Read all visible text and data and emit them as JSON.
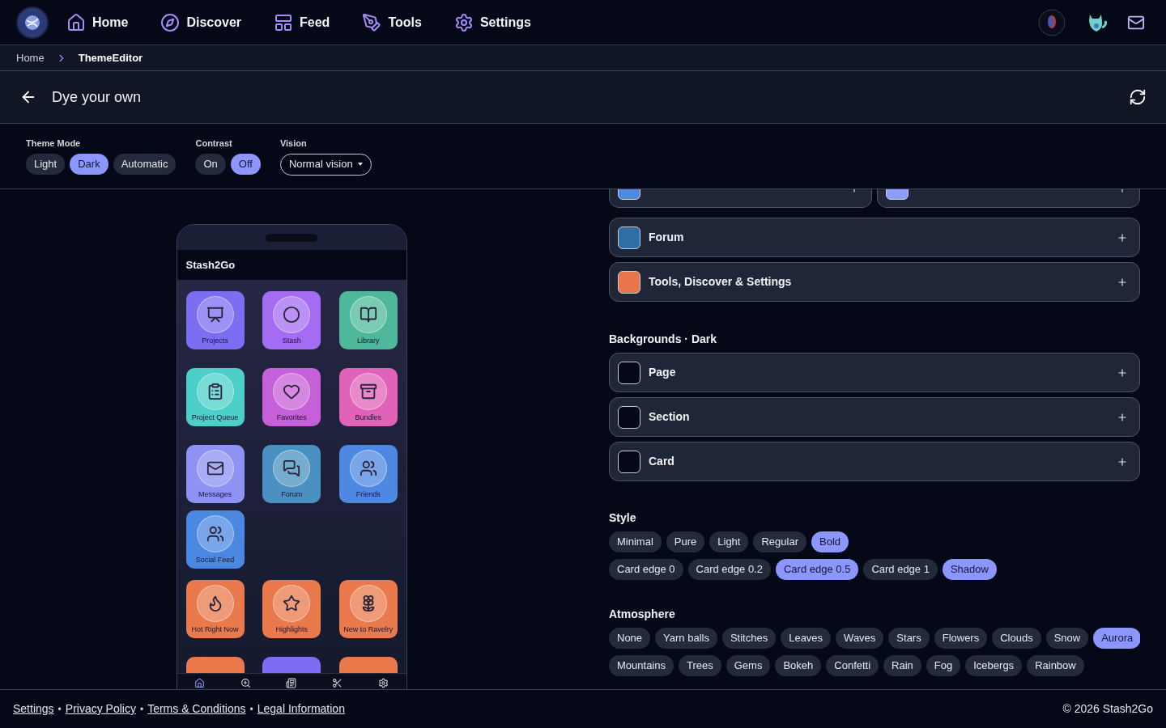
{
  "nav": {
    "items": [
      {
        "label": "Home"
      },
      {
        "label": "Discover"
      },
      {
        "label": "Feed"
      },
      {
        "label": "Tools"
      },
      {
        "label": "Settings"
      }
    ]
  },
  "breadcrumb": [
    {
      "label": "Home",
      "current": false
    },
    {
      "label": "ThemeEditor",
      "current": true
    }
  ],
  "header": {
    "title": "Dye your own"
  },
  "controls": {
    "theme_mode": {
      "label": "Theme Mode",
      "options": [
        {
          "label": "Light",
          "selected": false
        },
        {
          "label": "Dark",
          "selected": true
        },
        {
          "label": "Automatic",
          "selected": false
        }
      ]
    },
    "contrast": {
      "label": "Contrast",
      "options": [
        {
          "label": "On",
          "selected": false
        },
        {
          "label": "Off",
          "selected": true
        }
      ]
    },
    "vision": {
      "label": "Vision",
      "value": "Normal vision"
    }
  },
  "preview": {
    "app_title": "Stash2Go",
    "tiles": [
      {
        "label": "Projects",
        "color": "#7b6ef2"
      },
      {
        "label": "Stash",
        "color": "#a46cf2"
      },
      {
        "label": "Library",
        "color": "#4fb89b"
      },
      {
        "label": "Project Queue",
        "color": "#4ccfc8"
      },
      {
        "label": "Favorites",
        "color": "#c660d8"
      },
      {
        "label": "Bundles",
        "color": "#e062b9"
      },
      {
        "label": "Messages",
        "color": "#8e92f2"
      },
      {
        "label": "Forum",
        "color": "#4a90c2"
      },
      {
        "label": "Friends",
        "color": "#4e88e2"
      },
      {
        "label": "Social Feed",
        "color": "#4b88e2"
      },
      {
        "label": "Hot Right Now",
        "color": "#ea7a4c"
      },
      {
        "label": "Highlights",
        "color": "#ea7a4c"
      },
      {
        "label": "New to Ravelry",
        "color": "#ea7a4c"
      },
      {
        "color": "#ea7a4c"
      },
      {
        "color": "#7d6df5"
      },
      {
        "color": "#ea7a4c"
      }
    ],
    "tabbar": [
      {
        "selected": true
      },
      {
        "selected": false
      },
      {
        "selected": false
      },
      {
        "selected": false
      },
      {
        "selected": false
      }
    ]
  },
  "editor": {
    "pair": [
      {
        "color": "#4e88e2"
      },
      {
        "color": "#8e9bff"
      }
    ],
    "categories": [
      {
        "label": "Forum",
        "color": "#2f6ea6"
      },
      {
        "label": "Tools, Discover & Settings",
        "color": "#e8764a"
      }
    ],
    "backgrounds": {
      "title": "Backgrounds · Dark",
      "items": [
        {
          "label": "Page",
          "color": "#050816"
        },
        {
          "label": "Section",
          "color": "#050816"
        },
        {
          "label": "Card",
          "color": "#050816"
        }
      ]
    },
    "style": {
      "title": "Style",
      "weights": [
        {
          "label": "Minimal",
          "selected": false
        },
        {
          "label": "Pure",
          "selected": false
        },
        {
          "label": "Light",
          "selected": false
        },
        {
          "label": "Regular",
          "selected": false
        },
        {
          "label": "Bold",
          "selected": true
        }
      ],
      "edges": [
        {
          "label": "Card edge 0",
          "selected": false
        },
        {
          "label": "Card edge 0.2",
          "selected": false
        },
        {
          "label": "Card edge 0.5",
          "selected": true
        },
        {
          "label": "Card edge 1",
          "selected": false
        },
        {
          "label": "Shadow",
          "selected": true
        }
      ]
    },
    "atmosphere": {
      "title": "Atmosphere",
      "options": [
        {
          "label": "None",
          "selected": false
        },
        {
          "label": "Yarn balls",
          "selected": false
        },
        {
          "label": "Stitches",
          "selected": false
        },
        {
          "label": "Leaves",
          "selected": false
        },
        {
          "label": "Waves",
          "selected": false
        },
        {
          "label": "Stars",
          "selected": false
        },
        {
          "label": "Flowers",
          "selected": false
        },
        {
          "label": "Clouds",
          "selected": false
        },
        {
          "label": "Snow",
          "selected": false
        },
        {
          "label": "Aurora",
          "selected": true
        },
        {
          "label": "Mountains",
          "selected": false
        },
        {
          "label": "Trees",
          "selected": false
        },
        {
          "label": "Gems",
          "selected": false
        },
        {
          "label": "Bokeh",
          "selected": false
        },
        {
          "label": "Confetti",
          "selected": false
        },
        {
          "label": "Rain",
          "selected": false
        },
        {
          "label": "Fog",
          "selected": false
        },
        {
          "label": "Icebergs",
          "selected": false
        },
        {
          "label": "Rainbow",
          "selected": false
        }
      ]
    }
  },
  "footer": {
    "links": [
      "Settings",
      "Privacy Policy",
      "Terms & Conditions",
      "Legal Information"
    ],
    "separator": "•",
    "copyright": "© 2026 Stash2Go"
  }
}
